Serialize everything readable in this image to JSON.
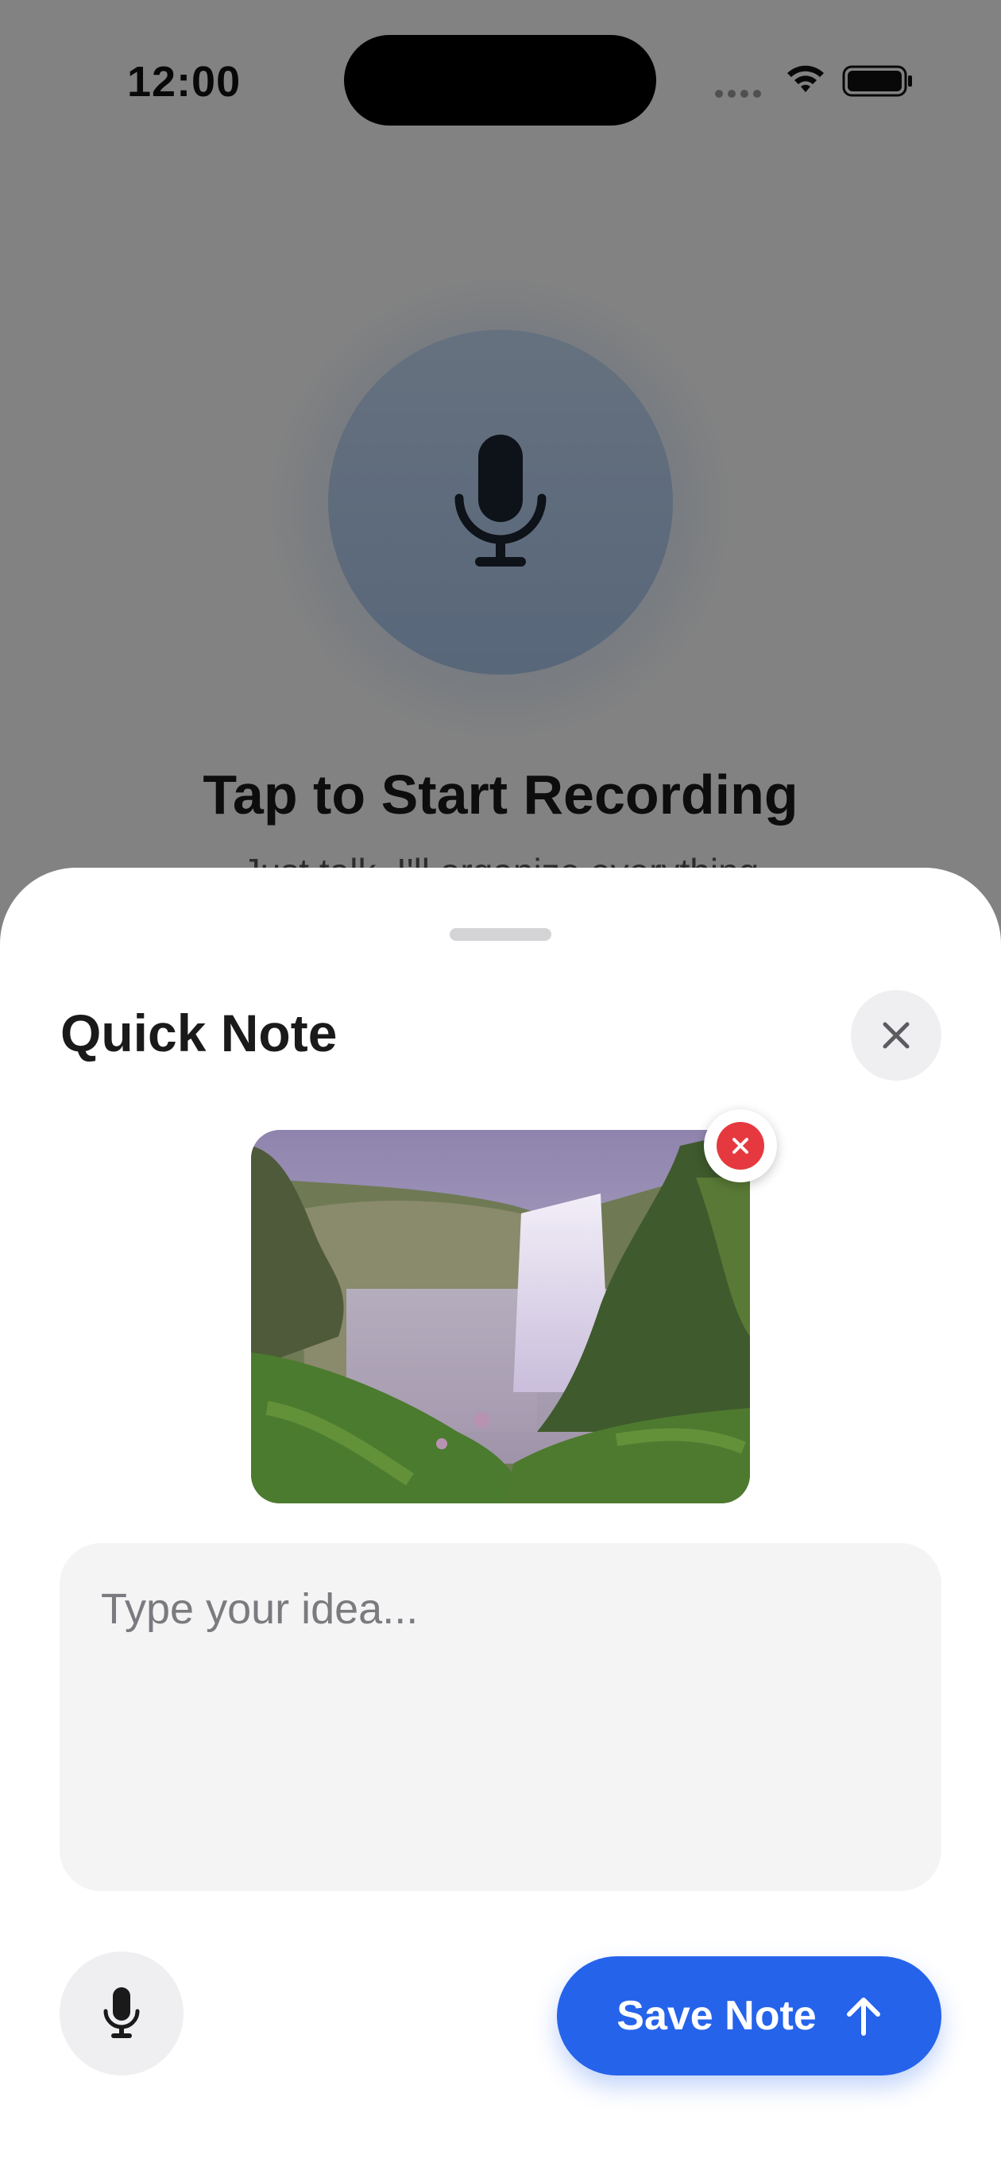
{
  "status_bar": {
    "time": "12:00",
    "icons": [
      "signal-icon",
      "wifi-icon",
      "battery-icon"
    ]
  },
  "background": {
    "title": "Tap to Start Recording",
    "subtitle": "Just talk. I'll organize everything",
    "mic_icon": "microphone-icon"
  },
  "sheet": {
    "title": "Quick Note",
    "close_icon": "close-icon",
    "attachment": {
      "remove_icon": "remove-icon"
    },
    "input": {
      "value": "",
      "placeholder": "Type your idea..."
    },
    "voice_icon": "microphone-icon",
    "save_button": {
      "label": "Save Note",
      "icon": "arrow-up-icon"
    }
  },
  "colors": {
    "accent": "#2563eb",
    "remove": "#e5393f",
    "input_background": "#f4f4f5"
  }
}
